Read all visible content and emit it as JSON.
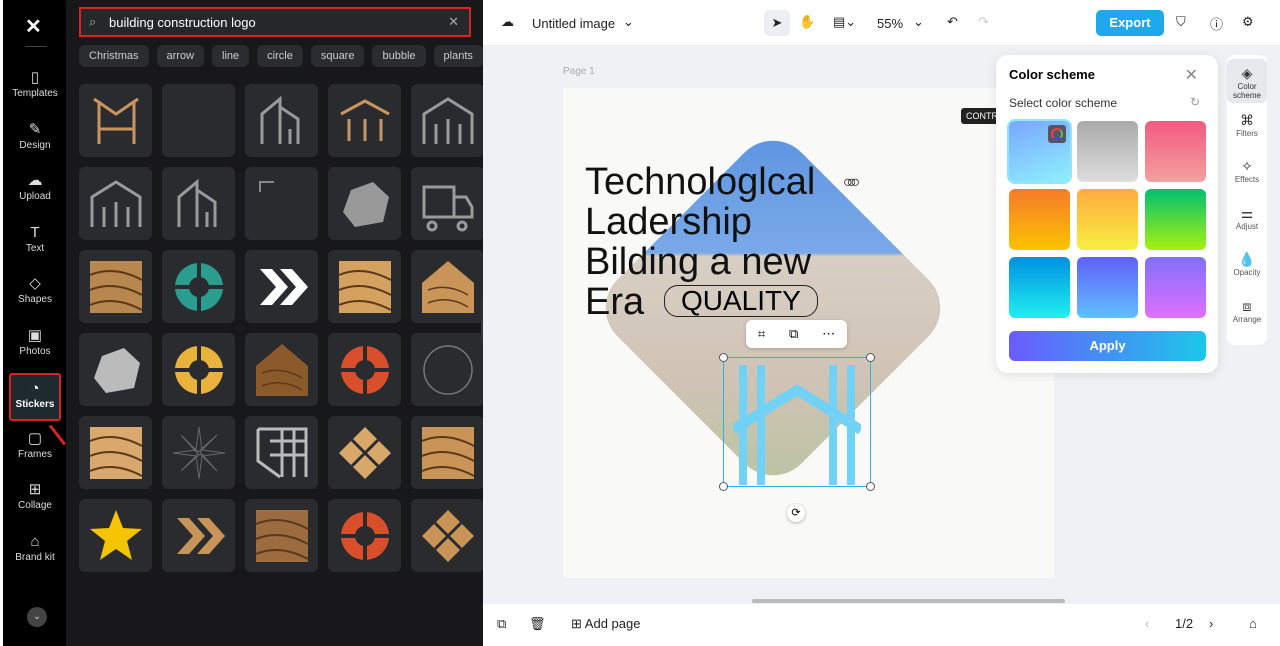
{
  "rail": {
    "items": [
      {
        "label": "Templates",
        "icon": "templates-icon",
        "glyph": "▯"
      },
      {
        "label": "Design",
        "icon": "design-icon",
        "glyph": "✎"
      },
      {
        "label": "Upload",
        "icon": "upload-icon",
        "glyph": "☁"
      },
      {
        "label": "Text",
        "icon": "text-icon",
        "glyph": "T"
      },
      {
        "label": "Shapes",
        "icon": "shapes-icon",
        "glyph": "◇"
      },
      {
        "label": "Photos",
        "icon": "photos-icon",
        "glyph": "▣"
      },
      {
        "label": "Stickers",
        "icon": "stickers-icon",
        "glyph": "◔"
      },
      {
        "label": "Frames",
        "icon": "frames-icon",
        "glyph": "▢"
      },
      {
        "label": "Collage",
        "icon": "collage-icon",
        "glyph": "⊞"
      },
      {
        "label": "Brand kit",
        "icon": "brand-kit-icon",
        "glyph": "⌂"
      }
    ],
    "active": "Stickers"
  },
  "search": {
    "value": "building construction logo"
  },
  "chips": [
    "Christmas",
    "arrow",
    "line",
    "circle",
    "square",
    "bubble",
    "plants"
  ],
  "stickers": [
    {
      "kind": "h-frame",
      "color": "#c8955e"
    },
    {
      "kind": "blank",
      "color": "#2a2b2f"
    },
    {
      "kind": "building",
      "color": "#9a9a9a"
    },
    {
      "kind": "roof-bars",
      "color": "#c8955e"
    },
    {
      "kind": "house-bars",
      "color": "#9a9a9a"
    },
    {
      "kind": "house-bars",
      "color": "#9a9a9a"
    },
    {
      "kind": "building",
      "color": "#9a9a9a"
    },
    {
      "kind": "corner",
      "color": "#888"
    },
    {
      "kind": "rock",
      "color": "#999"
    },
    {
      "kind": "truck",
      "color": "#9a9a9a"
    },
    {
      "kind": "wood",
      "color": "#b8864f"
    },
    {
      "kind": "circle-split",
      "color": "#2a9d8f"
    },
    {
      "kind": "chevrons",
      "color": "#fff"
    },
    {
      "kind": "wood",
      "color": "#d4a15f"
    },
    {
      "kind": "wood-house",
      "color": "#c89458"
    },
    {
      "kind": "rock",
      "color": "#bbb"
    },
    {
      "kind": "circle-split",
      "color": "#e9b23a"
    },
    {
      "kind": "wood-house",
      "color": "#8b5a2b"
    },
    {
      "kind": "circle-split",
      "color": "#d94f2b"
    },
    {
      "kind": "ring",
      "color": "#777"
    },
    {
      "kind": "wood",
      "color": "#d9a86c"
    },
    {
      "kind": "burst",
      "color": "#666"
    },
    {
      "kind": "grid",
      "color": "#bbb"
    },
    {
      "kind": "diamond",
      "color": "#d8a86a"
    },
    {
      "kind": "wood",
      "color": "#c89458"
    },
    {
      "kind": "star",
      "color": "#f5c400"
    },
    {
      "kind": "chevrons",
      "color": "#c89458"
    },
    {
      "kind": "wood",
      "color": "#9c6b3f"
    },
    {
      "kind": "circle-split",
      "color": "#d94f2b"
    },
    {
      "kind": "diamond",
      "color": "#c89458"
    }
  ],
  "topbar": {
    "title": "Untitled image",
    "zoom": "55%",
    "export": "Export"
  },
  "canvas": {
    "page_label": "Page 1",
    "headline": [
      "Technologlcal",
      "Ladership",
      "Bilding a new",
      "Era"
    ],
    "quality": "QUALITY",
    "tag": "CONTR"
  },
  "color_scheme": {
    "title": "Color scheme",
    "subtitle": "Select color scheme",
    "apply": "Apply",
    "swatches": [
      "linear-gradient(160deg,#7aa6ff,#8ef0ff)",
      "linear-gradient(180deg,#aaa,#ddd)",
      "linear-gradient(180deg,#f25a80,#f3a0a0)",
      "linear-gradient(180deg,#f57a2a,#fbc400)",
      "linear-gradient(180deg,#ffab40,#f7f040)",
      "linear-gradient(180deg,#00c070,#a8f010)",
      "linear-gradient(180deg,#0090e0,#20f0f0)",
      "linear-gradient(180deg,#6060f8,#60c0ff)",
      "linear-gradient(180deg,#8070f8,#e070ff)"
    ],
    "selected": 0
  },
  "tools": [
    {
      "label": "Color scheme",
      "glyph": "◈",
      "icon": "paint-bucket-icon"
    },
    {
      "label": "Filters",
      "glyph": "⌘",
      "icon": "filters-icon"
    },
    {
      "label": "Effects",
      "glyph": "✧",
      "icon": "effects-icon"
    },
    {
      "label": "Adjust",
      "glyph": "⚌",
      "icon": "adjust-icon"
    },
    {
      "label": "Opacity",
      "glyph": "💧",
      "icon": "opacity-icon"
    },
    {
      "label": "Arrange",
      "glyph": "⧈",
      "icon": "arrange-icon"
    }
  ],
  "bottom": {
    "add_page": "Add page",
    "page_count": "1/2"
  }
}
